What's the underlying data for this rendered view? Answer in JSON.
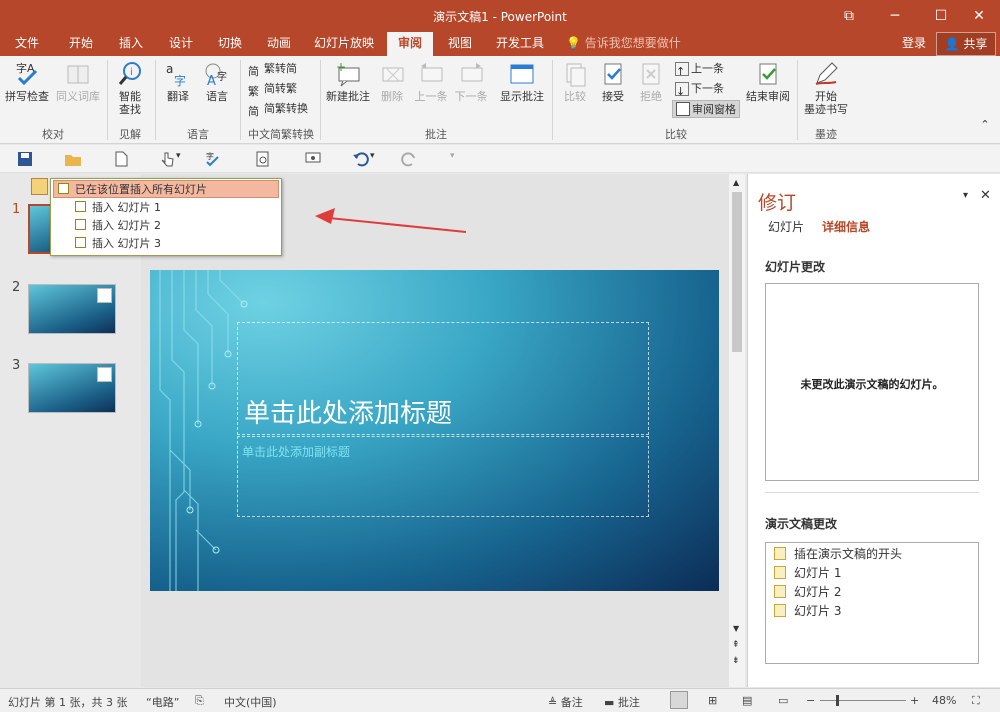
{
  "window": {
    "title": "演示文稿1 - PowerPoint",
    "controls": [
      "restore-ribbon-icon",
      "minimize-icon",
      "maximize-icon",
      "close-icon"
    ]
  },
  "tabs": [
    {
      "label": "文件"
    },
    {
      "label": "开始"
    },
    {
      "label": "插入"
    },
    {
      "label": "设计"
    },
    {
      "label": "切换"
    },
    {
      "label": "动画"
    },
    {
      "label": "幻灯片放映"
    },
    {
      "label": "审阅",
      "active": true
    },
    {
      "label": "视图"
    },
    {
      "label": "开发工具"
    }
  ],
  "tellme": "告诉我您想要做什么...",
  "login": "登录",
  "share": "共享",
  "ribbon": {
    "spell": "拼写检查",
    "thesaurus": "同义词库",
    "smart_lookup_1": "智能",
    "smart_lookup_2": "查找",
    "translate": "翻译",
    "language": "语言",
    "to_traditional": "繁转简",
    "to_simplified": "简转繁",
    "convert": "简繁转换",
    "new_comment": "新建批注",
    "delete": "删除",
    "previous": "上一条",
    "next": "下一条",
    "show_comments": "显示批注",
    "compare": "比较",
    "accept": "接受",
    "reject": "拒绝",
    "cmp_prev": "上一条",
    "cmp_next": "下一条",
    "reviewing_pane": "审阅窗格",
    "end_review": "结束审阅",
    "ink_1": "开始",
    "ink_2": "墨迹书写",
    "groups": {
      "proofing": "校对",
      "insights": "见解",
      "language": "语言",
      "chinese_conv": "中文简繁转换",
      "comments": "批注",
      "compare": "比较",
      "ink": "墨迹"
    }
  },
  "popup": {
    "all": "已在该位置插入所有幻灯片",
    "items": [
      "插入 幻灯片 1",
      "插入 幻灯片 2",
      "插入 幻灯片 3"
    ]
  },
  "thumbnails": [
    "1",
    "2",
    "3"
  ],
  "slide": {
    "title": "单击此处添加标题",
    "subtitle": "单击此处添加副标题"
  },
  "revisions": {
    "title": "修订",
    "tab_slides": "幻灯片",
    "tab_details": "详细信息",
    "slide_changes": "幻灯片更改",
    "no_changes": "未更改此演示文稿的幻灯片。",
    "pres_changes": "演示文稿更改",
    "items": [
      "插在演示文稿的开头",
      "幻灯片 1",
      "幻灯片 2",
      "幻灯片 3"
    ]
  },
  "status": {
    "slide_info": "幻灯片 第 1 张，共 3 张",
    "theme": "“电路”",
    "language": "中文(中国)",
    "notes": "备注",
    "comments": "批注",
    "zoom": "48%"
  },
  "colors": {
    "accent": "#b7472a"
  }
}
